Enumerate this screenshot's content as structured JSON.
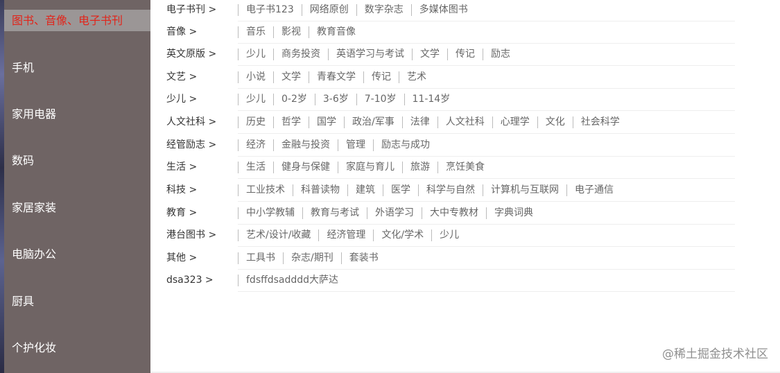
{
  "sidebar": {
    "items": [
      {
        "label": "图书、音像、电子书刊",
        "active": true
      },
      {
        "label": "手机"
      },
      {
        "label": "家用电器"
      },
      {
        "label": "数码"
      },
      {
        "label": "家居家装"
      },
      {
        "label": "电脑办公"
      },
      {
        "label": "厨具"
      },
      {
        "label": "个护化妆"
      }
    ]
  },
  "categories": [
    {
      "title": "电子书刊 >",
      "items": [
        "电子书123",
        "网络原创",
        "数字杂志",
        "多媒体图书"
      ]
    },
    {
      "title": "音像 >",
      "items": [
        "音乐",
        "影视",
        "教育音像"
      ]
    },
    {
      "title": "英文原版 >",
      "items": [
        "少儿",
        "商务投资",
        "英语学习与考试",
        "文学",
        "传记",
        "励志"
      ]
    },
    {
      "title": "文艺 >",
      "items": [
        "小说",
        "文学",
        "青春文学",
        "传记",
        "艺术"
      ]
    },
    {
      "title": "少儿 >",
      "items": [
        "少儿",
        "0-2岁",
        "3-6岁",
        "7-10岁",
        "11-14岁"
      ]
    },
    {
      "title": "人文社科 >",
      "items": [
        "历史",
        "哲学",
        "国学",
        "政治/军事",
        "法律",
        "人文社科",
        "心理学",
        "文化",
        "社会科学"
      ]
    },
    {
      "title": "经管励志 >",
      "items": [
        "经济",
        "金融与投资",
        "管理",
        "励志与成功"
      ]
    },
    {
      "title": "生活 >",
      "items": [
        "生活",
        "健身与保健",
        "家庭与育儿",
        "旅游",
        "烹饪美食"
      ]
    },
    {
      "title": "科技 >",
      "items": [
        "工业技术",
        "科普读物",
        "建筑",
        "医学",
        "科学与自然",
        "计算机与互联网",
        "电子通信"
      ]
    },
    {
      "title": "教育 >",
      "items": [
        "中小学教辅",
        "教育与考试",
        "外语学习",
        "大中专教材",
        "字典词典"
      ]
    },
    {
      "title": "港台图书 >",
      "items": [
        "艺术/设计/收藏",
        "经济管理",
        "文化/学术",
        "少儿"
      ]
    },
    {
      "title": "其他 >",
      "items": [
        "工具书",
        "杂志/期刊",
        "套装书"
      ]
    },
    {
      "title": "dsa323 >",
      "items": [
        "fdsffdsadddd大萨达"
      ]
    }
  ],
  "watermark": "@稀土掘金技术社区"
}
